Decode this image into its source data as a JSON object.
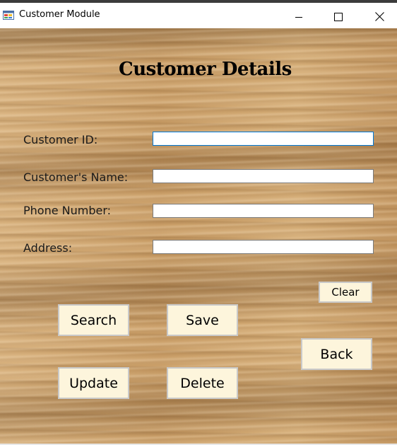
{
  "window": {
    "title": "Customer Module",
    "icon": "app-window-icon",
    "controls": [
      "minimize-icon",
      "maximize-icon",
      "close-icon"
    ]
  },
  "form": {
    "heading": "Customer Details",
    "fields": {
      "customer_id": {
        "label": "Customer ID:",
        "value": ""
      },
      "customer_name": {
        "label": "Customer's Name:",
        "value": ""
      },
      "phone_number": {
        "label": "Phone Number:",
        "value": ""
      },
      "address": {
        "label": "Address:",
        "value": ""
      }
    }
  },
  "buttons": {
    "clear": "Clear",
    "search": "Search",
    "save": "Save",
    "back": "Back",
    "update": "Update",
    "delete": "Delete"
  },
  "colors": {
    "button_face": "#fdf5dc",
    "focus_border": "#0078d7",
    "wood": "#caa06a"
  }
}
